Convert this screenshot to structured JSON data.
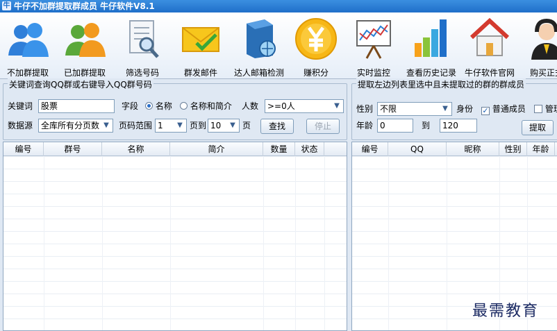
{
  "window": {
    "title": "牛仔不加群提取群成员  牛仔软件V8.1"
  },
  "toolbar": [
    {
      "label": "不加群提取",
      "icon": "users-blue-icon"
    },
    {
      "label": "已加群提取",
      "icon": "users-orange-icon"
    },
    {
      "label": "筛选号码",
      "icon": "document-magnifier-icon"
    },
    {
      "label": "群发邮件",
      "icon": "envelope-icon"
    },
    {
      "label": "达人邮箱检测",
      "icon": "server-globe-icon"
    },
    {
      "label": "赚积分",
      "icon": "yen-coin-icon"
    },
    {
      "label": "实时监控",
      "icon": "chart-easel-icon"
    },
    {
      "label": "查看历史记录",
      "icon": "bar-chart-icon"
    },
    {
      "label": "牛仔软件官网",
      "icon": "house-icon"
    },
    {
      "label": "购买正式",
      "icon": "support-agent-icon"
    }
  ],
  "left_panel": {
    "legend": "关键词查询QQ群或右键导入QQ群号码",
    "keyword_label": "关键词",
    "keyword_value": "股票",
    "field_label": "字段",
    "field_option_name": "名称",
    "field_option_name_intro": "名称和简介",
    "people_label": "人数",
    "people_value": ">=0人",
    "source_label": "数据源",
    "source_value": "全库所有分页数",
    "page_range_label": "页码范围",
    "page_from": "1",
    "page_to_label": "页到",
    "page_to": "10",
    "page_suffix": "页",
    "search_button": "查找",
    "stop_button": "停止"
  },
  "right_panel": {
    "legend": "提取左边列表里选中且未提取过的群的群成员",
    "gender_label": "性别",
    "gender_value": "不限",
    "identity_label": "身份",
    "member_option": "普通成员",
    "admin_option": "管理",
    "age_label": "年龄",
    "age_from": "0",
    "age_to_label": "到",
    "age_to": "120",
    "extract_button": "提取"
  },
  "left_table": {
    "columns": [
      "编号",
      "群号",
      "名称",
      "简介",
      "数量",
      "状态"
    ]
  },
  "right_table": {
    "columns": [
      "编号",
      "QQ",
      "昵称",
      "性别",
      "年龄"
    ]
  },
  "watermark": "最需教育",
  "colors": {
    "accent": "#1f6fc9",
    "background": "#dfe8f3"
  }
}
